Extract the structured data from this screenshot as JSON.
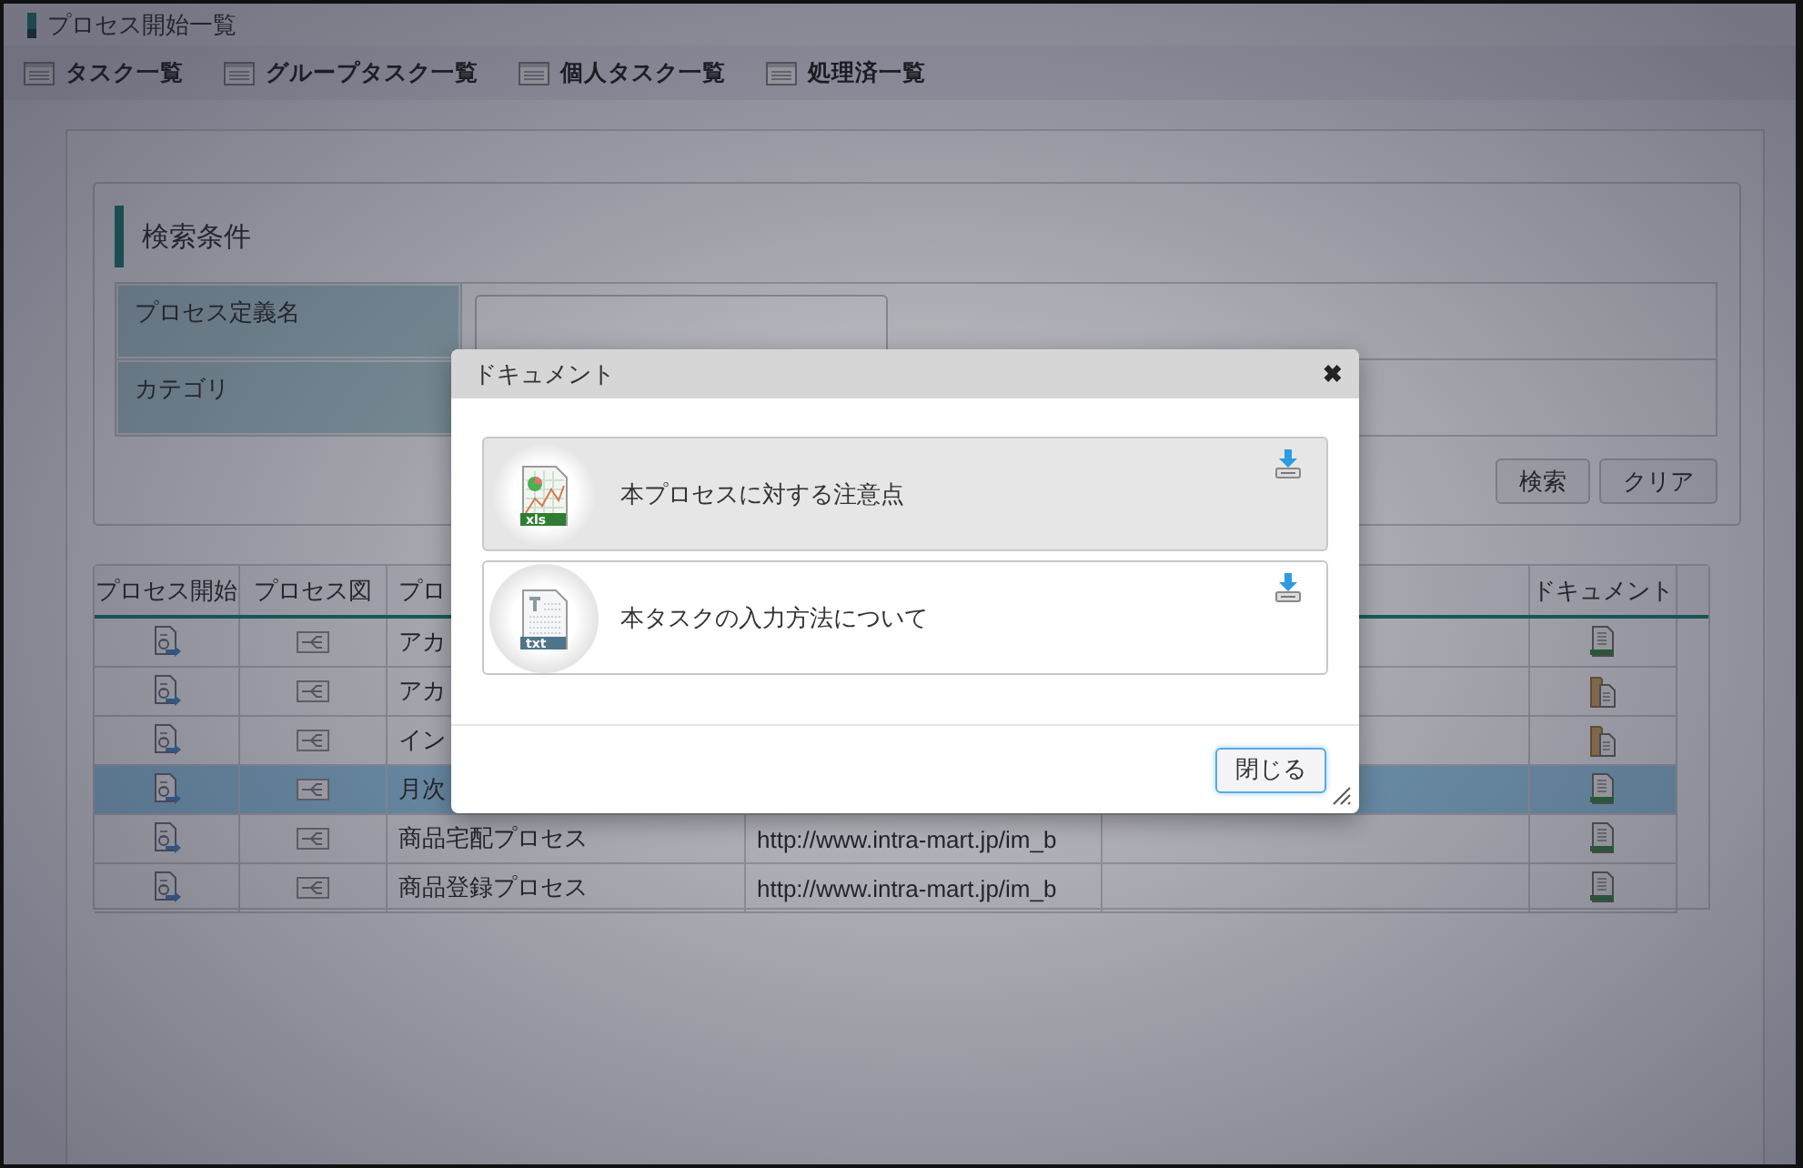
{
  "page_title": "プロセス開始一覧",
  "nav_links": [
    {
      "label": "タスク一覧"
    },
    {
      "label": "グループタスク一覧"
    },
    {
      "label": "個人タスク一覧"
    },
    {
      "label": "処理済一覧"
    }
  ],
  "search": {
    "heading": "検索条件",
    "fields": [
      {
        "label": "プロセス定義名",
        "kind": "text"
      },
      {
        "label": "カテゴリ",
        "kind": "none"
      }
    ],
    "buttons": [
      "検索",
      "クリア"
    ]
  },
  "grid": {
    "columns": [
      {
        "label": "プロセス開始"
      },
      {
        "label": "プロセス図"
      },
      {
        "label": "プロ"
      },
      {},
      {},
      {
        "label": "ドキュメント"
      }
    ],
    "rows": [
      {
        "name": "アカ",
        "kind": "single",
        "selected": false
      },
      {
        "name": "アカ",
        "kind": "multiple",
        "selected": false
      },
      {
        "name": "イン",
        "kind": "multiple",
        "selected": false
      },
      {
        "name": "月次",
        "kind": "single",
        "selected": true
      },
      {
        "name": "商品宅配プロセス",
        "url": "http://www.intra-mart.jp/im_b",
        "kind": "single",
        "selected": false
      },
      {
        "name": "商品登録プロセス",
        "url": "http://www.intra-mart.jp/im_b",
        "kind": "single",
        "selected": false
      }
    ]
  },
  "dialog": {
    "title": "ドキュメント",
    "close_glyph": "✖",
    "documents": [
      {
        "title": "本プロセスに対する注意点",
        "kind": "spreadsheet",
        "badge": "xls",
        "selected": true
      },
      {
        "title": "本タスクの入力方法について",
        "kind": "text",
        "badge": "txt",
        "selected": false
      }
    ],
    "button": "閉じる"
  }
}
